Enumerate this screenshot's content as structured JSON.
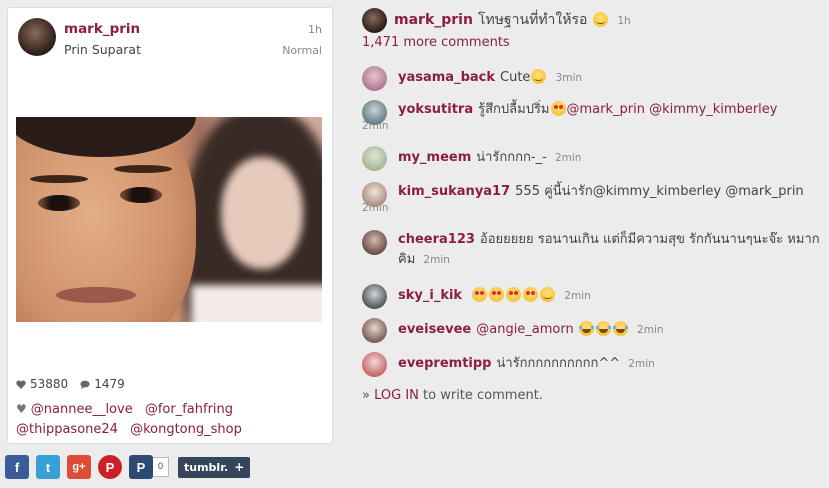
{
  "post": {
    "username": "mark_prin",
    "full_name": "Prin Suparat",
    "time": "1h",
    "filter": "Normal",
    "likes": "53880",
    "comments_count": "1479",
    "tags": [
      "@nannee__love",
      "@for_fahfring",
      "@thippasone24",
      "@kongtong_shop"
    ]
  },
  "share": {
    "pinit_count": "0",
    "tumblr_label": "tumblr.",
    "tumblr_plus": "+"
  },
  "caption": {
    "username": "mark_prin",
    "text": "โทษฐานที่ทำให้รอ",
    "emoji": "smile",
    "time": "1h"
  },
  "more_comments": "1,471 more comments",
  "comments": [
    {
      "username": "yasama_back",
      "text": "Cute",
      "emoji": [
        "smile"
      ],
      "time": "3min"
    },
    {
      "username": "yoksutitra",
      "text": "รู้สึกปลื้มปริ่ม",
      "emoji": [
        "heart"
      ],
      "mentions": "@mark_prin @kimmy_kimberley",
      "time": "2min"
    },
    {
      "username": "my_meem",
      "text": "น่ารักกกก-_-",
      "time": "2min"
    },
    {
      "username": "kim_sukanya17",
      "text": "555 คู่นี้น่ารัก@kimmy_kimberley @mark_prin",
      "time": "2min"
    },
    {
      "username": "cheera123",
      "text": "อ้อยยยยย รอนานเกิน แต่ก็มีความสุข รักกันนานๆนะจ๊ะ หมากคิม",
      "time": "2min"
    },
    {
      "username": "sky_i_kik",
      "text": "",
      "emoji": [
        "heart",
        "heart",
        "heart",
        "heart",
        "smile"
      ],
      "time": "2min"
    },
    {
      "username": "eveisevee",
      "text": "@angie_amorn",
      "emoji": [
        "laugh",
        "laugh",
        "laugh"
      ],
      "time": "2min"
    },
    {
      "username": "evepremtipp",
      "text": "น่ารักกกกกกกกกก^^",
      "time": "2min"
    }
  ],
  "login": {
    "arrow": "»",
    "link": "LOG IN",
    "rest": "to write comment."
  },
  "colors": {
    "accent": "#8a1f3e",
    "background": "#ececec"
  }
}
